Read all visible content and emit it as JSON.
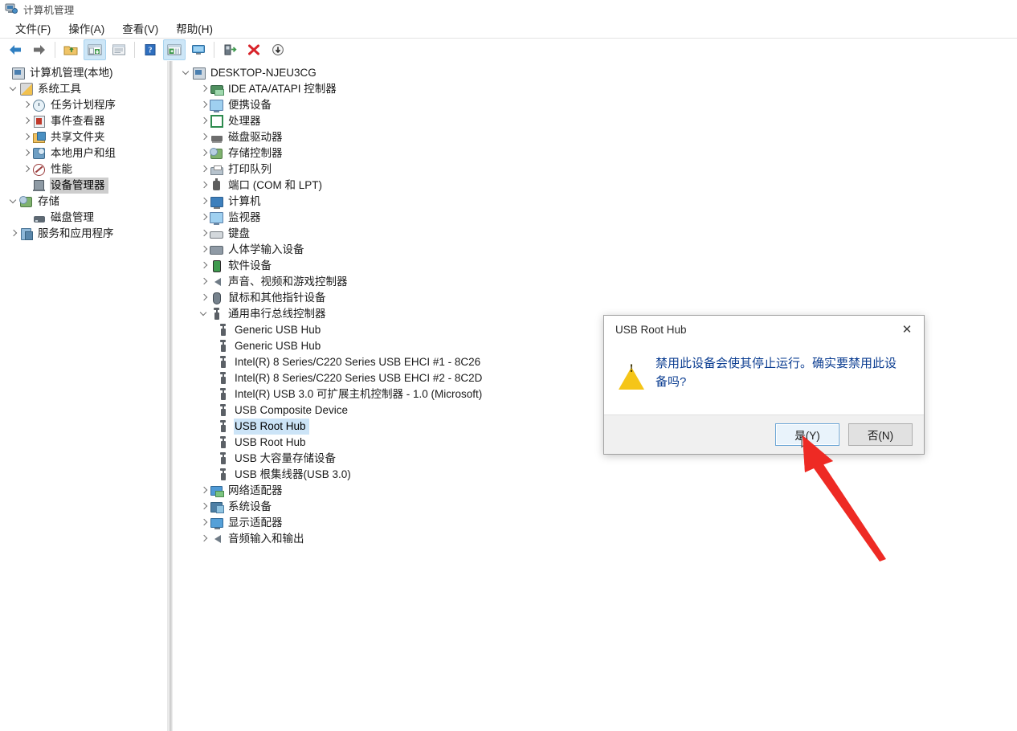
{
  "window": {
    "title": "计算机管理",
    "icon": "computer-management-icon"
  },
  "menubar": {
    "items": [
      {
        "label": "文件(F)",
        "name": "menu-file"
      },
      {
        "label": "操作(A)",
        "name": "menu-action"
      },
      {
        "label": "查看(V)",
        "name": "menu-view"
      },
      {
        "label": "帮助(H)",
        "name": "menu-help"
      }
    ]
  },
  "toolbar": {
    "buttons": [
      {
        "icon": "back-arrow-icon",
        "name": "toolbar-back",
        "active": false
      },
      {
        "icon": "forward-arrow-icon",
        "name": "toolbar-forward",
        "active": false
      },
      {
        "icon": "up-folder-icon",
        "name": "toolbar-up-folder",
        "active": false
      },
      {
        "icon": "show-console-tree-icon",
        "name": "toolbar-console-tree",
        "active": true
      },
      {
        "icon": "properties-window-icon",
        "name": "toolbar-properties",
        "active": false
      },
      {
        "icon": "help-icon",
        "name": "toolbar-help",
        "active": false
      },
      {
        "icon": "show-action-pane-icon",
        "name": "toolbar-action-pane",
        "active": true
      },
      {
        "icon": "monitor-icon",
        "name": "toolbar-monitor",
        "active": false
      },
      {
        "icon": "update-driver-icon",
        "name": "toolbar-update-driver",
        "active": false
      },
      {
        "icon": "uninstall-device-icon",
        "name": "toolbar-uninstall",
        "active": false
      },
      {
        "icon": "scan-hardware-icon",
        "name": "toolbar-scan-hardware",
        "active": false
      }
    ]
  },
  "sidebar": {
    "items": [
      {
        "label": "计算机管理(本地)",
        "indent": 0,
        "twist": "none",
        "icon": "computer-management-icon",
        "selected": "none"
      },
      {
        "label": "系统工具",
        "indent": 1,
        "twist": "down",
        "icon": "system-tools-icon",
        "selected": "none"
      },
      {
        "label": "任务计划程序",
        "indent": 2,
        "twist": "right",
        "icon": "task-scheduler-icon",
        "selected": "none"
      },
      {
        "label": "事件查看器",
        "indent": 2,
        "twist": "right",
        "icon": "event-viewer-icon",
        "selected": "none"
      },
      {
        "label": "共享文件夹",
        "indent": 2,
        "twist": "right",
        "icon": "shared-folders-icon",
        "selected": "none"
      },
      {
        "label": "本地用户和组",
        "indent": 2,
        "twist": "right",
        "icon": "local-users-groups-icon",
        "selected": "none"
      },
      {
        "label": "性能",
        "indent": 2,
        "twist": "right",
        "icon": "performance-icon",
        "selected": "none"
      },
      {
        "label": "设备管理器",
        "indent": 2,
        "twist": "none",
        "icon": "device-manager-icon",
        "selected": "gray"
      },
      {
        "label": "存储",
        "indent": 1,
        "twist": "down",
        "icon": "storage-icon",
        "selected": "none"
      },
      {
        "label": "磁盘管理",
        "indent": 2,
        "twist": "none",
        "icon": "disk-management-icon",
        "selected": "none"
      },
      {
        "label": "服务和应用程序",
        "indent": 1,
        "twist": "right",
        "icon": "services-applications-icon",
        "selected": "none"
      }
    ]
  },
  "device_tree": {
    "items": [
      {
        "label": "DESKTOP-NJEU3CG",
        "indent": 0,
        "twist": "down",
        "icon": "computer-node-icon",
        "selected": "none"
      },
      {
        "label": "IDE ATA/ATAPI 控制器",
        "indent": 1,
        "twist": "right",
        "icon": "ide-controller-icon",
        "selected": "none"
      },
      {
        "label": "便携设备",
        "indent": 1,
        "twist": "right",
        "icon": "portable-device-icon",
        "selected": "none"
      },
      {
        "label": "处理器",
        "indent": 1,
        "twist": "right",
        "icon": "processor-icon",
        "selected": "none"
      },
      {
        "label": "磁盘驱动器",
        "indent": 1,
        "twist": "right",
        "icon": "disk-drive-icon",
        "selected": "none"
      },
      {
        "label": "存储控制器",
        "indent": 1,
        "twist": "right",
        "icon": "storage-controller-icon",
        "selected": "none"
      },
      {
        "label": "打印队列",
        "indent": 1,
        "twist": "right",
        "icon": "print-queue-icon",
        "selected": "none"
      },
      {
        "label": "端口 (COM 和 LPT)",
        "indent": 1,
        "twist": "right",
        "icon": "ports-icon",
        "selected": "none"
      },
      {
        "label": "计算机",
        "indent": 1,
        "twist": "right",
        "icon": "computer-icon",
        "selected": "none"
      },
      {
        "label": "监视器",
        "indent": 1,
        "twist": "right",
        "icon": "monitor-icon",
        "selected": "none"
      },
      {
        "label": "键盘",
        "indent": 1,
        "twist": "right",
        "icon": "keyboard-icon",
        "selected": "none"
      },
      {
        "label": "人体学输入设备",
        "indent": 1,
        "twist": "right",
        "icon": "hid-icon",
        "selected": "none"
      },
      {
        "label": "软件设备",
        "indent": 1,
        "twist": "right",
        "icon": "software-device-icon",
        "selected": "none"
      },
      {
        "label": "声音、视频和游戏控制器",
        "indent": 1,
        "twist": "right",
        "icon": "sound-video-game-icon",
        "selected": "none"
      },
      {
        "label": "鼠标和其他指针设备",
        "indent": 1,
        "twist": "right",
        "icon": "mouse-pointer-icon",
        "selected": "none"
      },
      {
        "label": "通用串行总线控制器",
        "indent": 1,
        "twist": "down",
        "icon": "usb-controller-icon",
        "selected": "none"
      },
      {
        "label": "Generic USB Hub",
        "indent": 2,
        "twist": "none",
        "icon": "usb-device-icon",
        "selected": "none"
      },
      {
        "label": "Generic USB Hub",
        "indent": 2,
        "twist": "none",
        "icon": "usb-device-icon",
        "selected": "none"
      },
      {
        "label": "Intel(R) 8 Series/C220 Series USB EHCI #1 - 8C26",
        "indent": 2,
        "twist": "none",
        "icon": "usb-device-icon",
        "selected": "none"
      },
      {
        "label": "Intel(R) 8 Series/C220 Series USB EHCI #2 - 8C2D",
        "indent": 2,
        "twist": "none",
        "icon": "usb-device-icon",
        "selected": "none"
      },
      {
        "label": "Intel(R) USB 3.0 可扩展主机控制器 - 1.0 (Microsoft)",
        "indent": 2,
        "twist": "none",
        "icon": "usb-device-icon",
        "selected": "none"
      },
      {
        "label": "USB Composite Device",
        "indent": 2,
        "twist": "none",
        "icon": "usb-device-icon",
        "selected": "none"
      },
      {
        "label": "USB Root Hub",
        "indent": 2,
        "twist": "none",
        "icon": "usb-device-icon",
        "selected": "blue"
      },
      {
        "label": "USB Root Hub",
        "indent": 2,
        "twist": "none",
        "icon": "usb-device-icon",
        "selected": "none"
      },
      {
        "label": "USB 大容量存储设备",
        "indent": 2,
        "twist": "none",
        "icon": "usb-device-icon",
        "selected": "none"
      },
      {
        "label": "USB 根集线器(USB 3.0)",
        "indent": 2,
        "twist": "none",
        "icon": "usb-device-icon",
        "selected": "none"
      },
      {
        "label": "网络适配器",
        "indent": 1,
        "twist": "right",
        "icon": "network-adapter-icon",
        "selected": "none"
      },
      {
        "label": "系统设备",
        "indent": 1,
        "twist": "right",
        "icon": "system-device-icon",
        "selected": "none"
      },
      {
        "label": "显示适配器",
        "indent": 1,
        "twist": "right",
        "icon": "display-adapter-icon",
        "selected": "none"
      },
      {
        "label": "音频输入和输出",
        "indent": 1,
        "twist": "right",
        "icon": "audio-io-icon",
        "selected": "none"
      }
    ]
  },
  "dialog": {
    "title": "USB Root Hub",
    "close_label": "✕",
    "warning_icon": "warning-triangle-icon",
    "message": "禁用此设备会使其停止运行。确实要禁用此设备吗?",
    "buttons": [
      {
        "label": "是(Y)",
        "name": "dialog-yes-button",
        "focused": true
      },
      {
        "label": "否(N)",
        "name": "dialog-no-button",
        "focused": false
      }
    ]
  },
  "annotation": {
    "arrow_color": "#ee2a24",
    "target": "dialog-yes-button"
  },
  "colors": {
    "selection_blue": "#cce4f7",
    "selection_gray": "#cdcdcd",
    "dialog_text_blue": "#0b3d91",
    "toolbar_active": "#cde6f7",
    "warning_yellow": "#f5c518"
  }
}
